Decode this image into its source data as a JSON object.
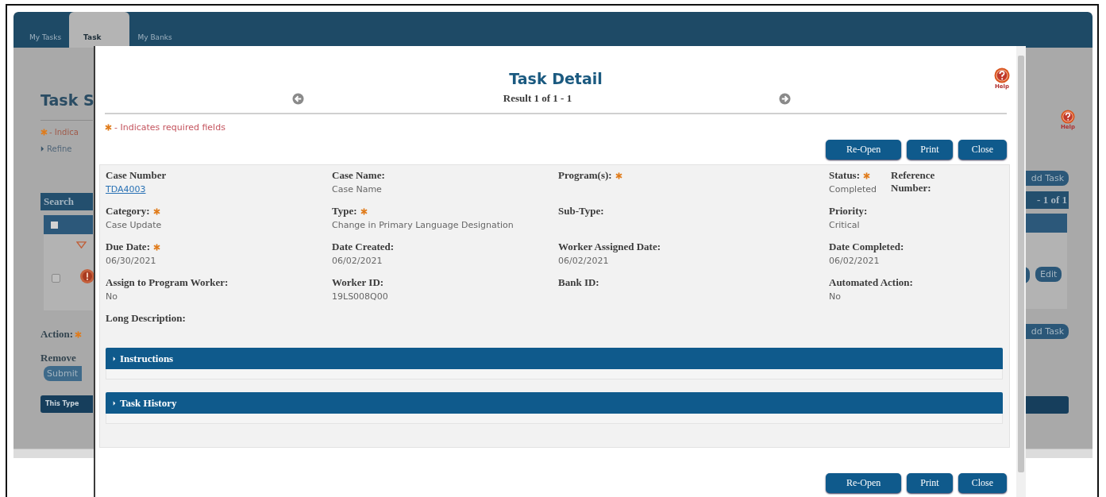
{
  "background_page": {
    "tabs": [
      {
        "label": "My Tasks",
        "selected": false
      },
      {
        "label": "Task",
        "selected": true
      },
      {
        "label": "My Banks",
        "selected": false
      }
    ],
    "title": "Task S",
    "required_note": "- Indica",
    "refine_link": "Refine",
    "search_header": "Search",
    "select_all_checked": false,
    "row_checked": false,
    "action": {
      "label": "Action:",
      "required": true
    },
    "remove_label": "Remove",
    "submit_button": "Submit",
    "note_bar": "This Type",
    "help_label": "Help",
    "add_task_buttons": [
      "dd Task",
      "dd Task"
    ],
    "pager": "- 1 of 1",
    "edit_button": "Edit"
  },
  "modal": {
    "title": "Task Detail",
    "help_label": "Help",
    "result": "Result 1 of 1 - 1",
    "required_note": "- Indicates required fields",
    "buttons": [
      "Re-Open",
      "Print",
      "Close"
    ],
    "rows": [
      [
        [
          {
            "label": "Case Number",
            "required": false,
            "value": "TDA4003",
            "kind": "link"
          }
        ],
        [
          {
            "label": "Case Name:",
            "required": false,
            "value": "Case Name",
            "kind": "text"
          }
        ],
        [
          {
            "label": "Program(s):",
            "required": true
          }
        ],
        [
          {
            "label": "Status:",
            "required": true,
            "value": "Completed",
            "kind": "text"
          },
          {
            "label": "Reference Number:",
            "required": false
          }
        ]
      ],
      [
        [
          {
            "label": "Category:",
            "required": true,
            "value": "Case Update",
            "kind": "text"
          }
        ],
        [
          {
            "label": "Type:",
            "required": true,
            "value": "Change in Primary Language Designation",
            "kind": "text"
          }
        ],
        [
          {
            "label": "Sub-Type:",
            "required": false
          }
        ],
        [
          {
            "label": "Priority:",
            "required": false,
            "value": "Critical",
            "kind": "text"
          }
        ]
      ],
      [
        [
          {
            "label": "Due Date:",
            "required": true,
            "value": "06/30/2021",
            "kind": "text"
          }
        ],
        [
          {
            "label": "Date Created:",
            "required": false,
            "value": "06/02/2021",
            "kind": "text"
          }
        ],
        [
          {
            "label": "Worker Assigned Date:",
            "required": false,
            "value": "06/02/2021",
            "kind": "text"
          }
        ],
        [
          {
            "label": "Date Completed:",
            "required": false,
            "value": "06/02/2021",
            "kind": "text"
          }
        ]
      ],
      [
        [
          {
            "label": "Assign to Program Worker:",
            "required": false,
            "value": "No",
            "kind": "text"
          }
        ],
        [
          {
            "label": "Worker ID:",
            "required": false,
            "value": "19LS008Q00",
            "kind": "text"
          }
        ],
        [
          {
            "label": "Bank ID:",
            "required": false
          }
        ],
        [
          {
            "label": "Automated Action:",
            "required": false,
            "value": "No",
            "kind": "text"
          }
        ]
      ],
      [
        [
          {
            "label": "Long Description:",
            "required": false
          }
        ]
      ]
    ],
    "sections": [
      {
        "label": "Instructions",
        "expanded": false
      },
      {
        "label": "Task History",
        "expanded": false
      }
    ],
    "bottom_buttons": [
      "Re-Open",
      "Print",
      "Close"
    ]
  }
}
